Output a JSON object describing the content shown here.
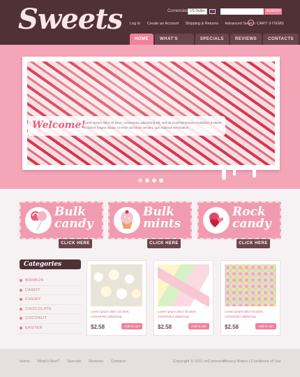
{
  "header": {
    "logo": "Sweets",
    "currency_label": "Currencies:",
    "currency_value": "US Dollar",
    "search_button": "SEARCH",
    "top_links": [
      "Log In",
      "Create an Account",
      "Shipping & Returns",
      "Advanced Search"
    ],
    "cart": "CART: 0 ITEMS"
  },
  "nav": {
    "items": [
      "HOME",
      "WHAT'S NEW?",
      "SPECIALS",
      "REVIEWS",
      "CONTACTS"
    ],
    "active": "HOME"
  },
  "banner": {
    "welcome_title": "Welcome!",
    "welcome_text": "Lorem ipsum dolor sit amet, consectetur adipisicing elit, sed do eiusmod tempor incididunt ut labore et dolore magna aliqua. Ut enim ad minim veniam, quis nostrud exercitation.",
    "slides": 4
  },
  "promos": [
    {
      "title_line1": "Bulk",
      "title_line2": "candy",
      "button": "CLICK HERE"
    },
    {
      "title_line1": "Bulk",
      "title_line2": "mints",
      "button": "CLICK HERE"
    },
    {
      "title_line1": "Rock",
      "title_line2": "candy",
      "button": "CLICK HERE"
    }
  ],
  "categories": {
    "title": "Categories",
    "items": [
      "BONBON",
      "CANDY",
      "CHEWY",
      "CHOCOLATE",
      "COCONUT",
      "EASTER"
    ]
  },
  "products": [
    {
      "desc": "Lorem ipsum dolor sit amet, consectetur adipiscing",
      "price": "$2.58",
      "button": "Add to cart"
    },
    {
      "desc": "Lorem ipsum dolor sit amet, consectetur adipiscing",
      "price": "$2.58",
      "button": "Add to cart"
    },
    {
      "desc": "Lorem ipsum dolor sit amet, consectetur adipiscing",
      "price": "$2.58",
      "button": "Add to cart"
    }
  ],
  "footer": {
    "links": [
      "Home",
      "What's New?",
      "Specials",
      "Reviews",
      "Contacts"
    ],
    "copyright": "Copyright © 2011 osCommerce",
    "right_links": [
      "Privacy Notice",
      "Conditions of Use"
    ]
  },
  "colors": {
    "brown": "#4f3136",
    "pink": "#f0819b",
    "light_pink": "#f4a6b8"
  }
}
